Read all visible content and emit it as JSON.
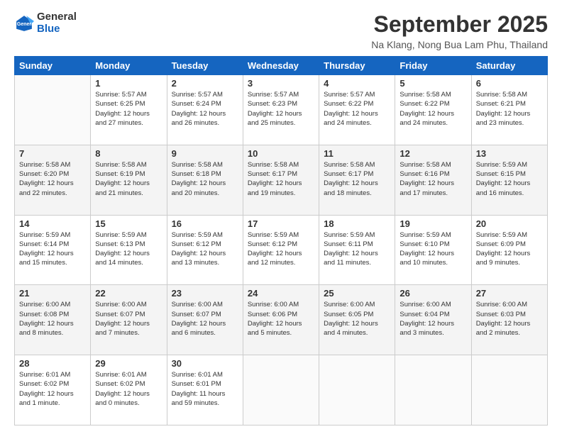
{
  "header": {
    "logo_line1": "General",
    "logo_line2": "Blue",
    "month": "September 2025",
    "location": "Na Klang, Nong Bua Lam Phu, Thailand"
  },
  "days_of_week": [
    "Sunday",
    "Monday",
    "Tuesday",
    "Wednesday",
    "Thursday",
    "Friday",
    "Saturday"
  ],
  "weeks": [
    [
      {
        "day": "",
        "info": ""
      },
      {
        "day": "1",
        "info": "Sunrise: 5:57 AM\nSunset: 6:25 PM\nDaylight: 12 hours\nand 27 minutes."
      },
      {
        "day": "2",
        "info": "Sunrise: 5:57 AM\nSunset: 6:24 PM\nDaylight: 12 hours\nand 26 minutes."
      },
      {
        "day": "3",
        "info": "Sunrise: 5:57 AM\nSunset: 6:23 PM\nDaylight: 12 hours\nand 25 minutes."
      },
      {
        "day": "4",
        "info": "Sunrise: 5:57 AM\nSunset: 6:22 PM\nDaylight: 12 hours\nand 24 minutes."
      },
      {
        "day": "5",
        "info": "Sunrise: 5:58 AM\nSunset: 6:22 PM\nDaylight: 12 hours\nand 24 minutes."
      },
      {
        "day": "6",
        "info": "Sunrise: 5:58 AM\nSunset: 6:21 PM\nDaylight: 12 hours\nand 23 minutes."
      }
    ],
    [
      {
        "day": "7",
        "info": "Sunrise: 5:58 AM\nSunset: 6:20 PM\nDaylight: 12 hours\nand 22 minutes."
      },
      {
        "day": "8",
        "info": "Sunrise: 5:58 AM\nSunset: 6:19 PM\nDaylight: 12 hours\nand 21 minutes."
      },
      {
        "day": "9",
        "info": "Sunrise: 5:58 AM\nSunset: 6:18 PM\nDaylight: 12 hours\nand 20 minutes."
      },
      {
        "day": "10",
        "info": "Sunrise: 5:58 AM\nSunset: 6:17 PM\nDaylight: 12 hours\nand 19 minutes."
      },
      {
        "day": "11",
        "info": "Sunrise: 5:58 AM\nSunset: 6:17 PM\nDaylight: 12 hours\nand 18 minutes."
      },
      {
        "day": "12",
        "info": "Sunrise: 5:58 AM\nSunset: 6:16 PM\nDaylight: 12 hours\nand 17 minutes."
      },
      {
        "day": "13",
        "info": "Sunrise: 5:59 AM\nSunset: 6:15 PM\nDaylight: 12 hours\nand 16 minutes."
      }
    ],
    [
      {
        "day": "14",
        "info": "Sunrise: 5:59 AM\nSunset: 6:14 PM\nDaylight: 12 hours\nand 15 minutes."
      },
      {
        "day": "15",
        "info": "Sunrise: 5:59 AM\nSunset: 6:13 PM\nDaylight: 12 hours\nand 14 minutes."
      },
      {
        "day": "16",
        "info": "Sunrise: 5:59 AM\nSunset: 6:12 PM\nDaylight: 12 hours\nand 13 minutes."
      },
      {
        "day": "17",
        "info": "Sunrise: 5:59 AM\nSunset: 6:12 PM\nDaylight: 12 hours\nand 12 minutes."
      },
      {
        "day": "18",
        "info": "Sunrise: 5:59 AM\nSunset: 6:11 PM\nDaylight: 12 hours\nand 11 minutes."
      },
      {
        "day": "19",
        "info": "Sunrise: 5:59 AM\nSunset: 6:10 PM\nDaylight: 12 hours\nand 10 minutes."
      },
      {
        "day": "20",
        "info": "Sunrise: 5:59 AM\nSunset: 6:09 PM\nDaylight: 12 hours\nand 9 minutes."
      }
    ],
    [
      {
        "day": "21",
        "info": "Sunrise: 6:00 AM\nSunset: 6:08 PM\nDaylight: 12 hours\nand 8 minutes."
      },
      {
        "day": "22",
        "info": "Sunrise: 6:00 AM\nSunset: 6:07 PM\nDaylight: 12 hours\nand 7 minutes."
      },
      {
        "day": "23",
        "info": "Sunrise: 6:00 AM\nSunset: 6:07 PM\nDaylight: 12 hours\nand 6 minutes."
      },
      {
        "day": "24",
        "info": "Sunrise: 6:00 AM\nSunset: 6:06 PM\nDaylight: 12 hours\nand 5 minutes."
      },
      {
        "day": "25",
        "info": "Sunrise: 6:00 AM\nSunset: 6:05 PM\nDaylight: 12 hours\nand 4 minutes."
      },
      {
        "day": "26",
        "info": "Sunrise: 6:00 AM\nSunset: 6:04 PM\nDaylight: 12 hours\nand 3 minutes."
      },
      {
        "day": "27",
        "info": "Sunrise: 6:00 AM\nSunset: 6:03 PM\nDaylight: 12 hours\nand 2 minutes."
      }
    ],
    [
      {
        "day": "28",
        "info": "Sunrise: 6:01 AM\nSunset: 6:02 PM\nDaylight: 12 hours\nand 1 minute."
      },
      {
        "day": "29",
        "info": "Sunrise: 6:01 AM\nSunset: 6:02 PM\nDaylight: 12 hours\nand 0 minutes."
      },
      {
        "day": "30",
        "info": "Sunrise: 6:01 AM\nSunset: 6:01 PM\nDaylight: 11 hours\nand 59 minutes."
      },
      {
        "day": "",
        "info": ""
      },
      {
        "day": "",
        "info": ""
      },
      {
        "day": "",
        "info": ""
      },
      {
        "day": "",
        "info": ""
      }
    ]
  ]
}
